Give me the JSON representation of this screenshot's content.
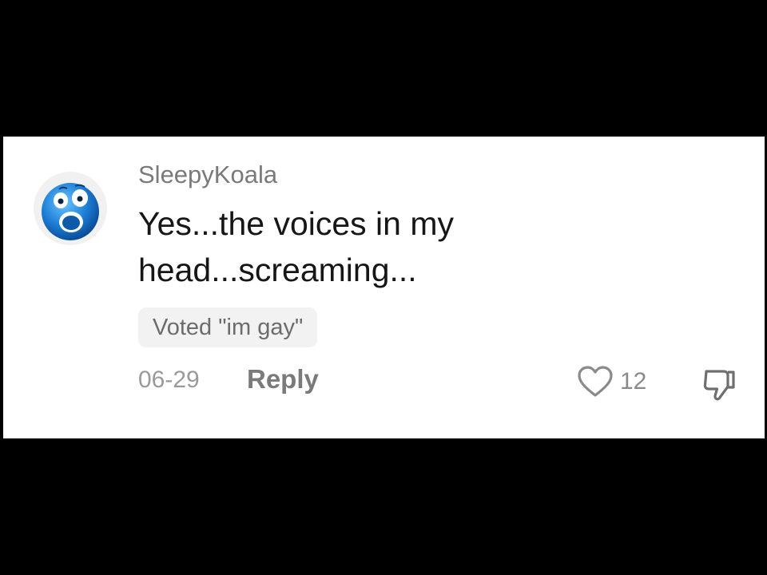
{
  "comment": {
    "username": "SleepyKoala",
    "avatar_icon": "screaming-blue-face-icon",
    "text": "Yes...the voices in my\nhead...screaming...",
    "vote_label": "Voted \"im gay\"",
    "date": "06-29",
    "reply_label": "Reply",
    "like_icon": "heart-outline-icon",
    "like_count": "12",
    "dislike_icon": "thumbs-down-icon"
  },
  "colors": {
    "background": "#000000",
    "card": "#ffffff",
    "username": "#7a7a7a",
    "comment_text": "#161616",
    "chip_background": "#f2f2f2",
    "muted": "#9a9a9a",
    "avatar_blue": "#1e7fd6"
  }
}
